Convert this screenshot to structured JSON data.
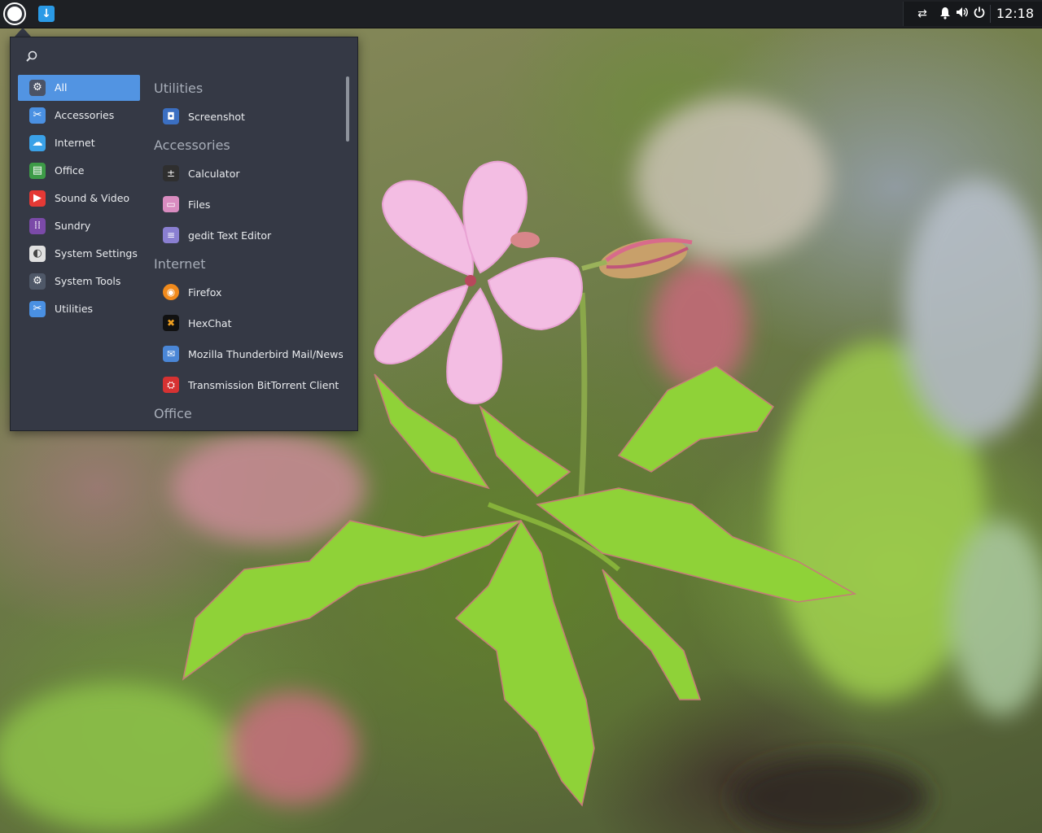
{
  "panel": {
    "menu_button_icon": "menu-circle-icon",
    "update_icon": "download-update-icon",
    "tray_icons": [
      "network-transfer-icon",
      "notification-bell-icon",
      "volume-icon",
      "power-icon"
    ],
    "clock": "12:18"
  },
  "menu": {
    "search_icon": "search-icon",
    "search_placeholder": "",
    "categories": [
      {
        "label": "All",
        "icon": "gear-icon",
        "color": "#4b5366",
        "active": true
      },
      {
        "label": "Accessories",
        "icon": "scissors-icon",
        "color": "#4a90e2"
      },
      {
        "label": "Internet",
        "icon": "cloud-icon",
        "color": "#3aa1e8"
      },
      {
        "label": "Office",
        "icon": "document-icon",
        "color": "#3d9b47"
      },
      {
        "label": "Sound & Video",
        "icon": "play-icon",
        "color": "#e53935"
      },
      {
        "label": "Sundry",
        "icon": "grid-icon",
        "color": "#7b4aa8"
      },
      {
        "label": "System Settings",
        "icon": "toggle-icon",
        "color": "#e0e0e0"
      },
      {
        "label": "System Tools",
        "icon": "gear-icon",
        "color": "#4f5868"
      },
      {
        "label": "Utilities",
        "icon": "scissors-icon",
        "color": "#4a90e2"
      }
    ],
    "sections": [
      {
        "title": "Utilities",
        "apps": [
          {
            "label": "Screenshot",
            "icon": "camera-icon",
            "color": "#3b6fc2"
          }
        ]
      },
      {
        "title": "Accessories",
        "apps": [
          {
            "label": "Calculator",
            "icon": "calculator-icon",
            "color": "#2f2f2f"
          },
          {
            "label": "Files",
            "icon": "folder-icon",
            "color": "#d98cc0"
          },
          {
            "label": "gedit Text Editor",
            "icon": "text-editor-icon",
            "color": "#8a7fd1"
          }
        ]
      },
      {
        "title": "Internet",
        "apps": [
          {
            "label": "Firefox",
            "icon": "firefox-icon",
            "color": "#f08a1c"
          },
          {
            "label": "HexChat",
            "icon": "hexchat-icon",
            "color": "#111111"
          },
          {
            "label": "Mozilla Thunderbird Mail/News",
            "icon": "mail-icon",
            "color": "#4a86d6"
          },
          {
            "label": "Transmission BitTorrent Client",
            "icon": "transmission-icon",
            "color": "#d63232"
          }
        ]
      },
      {
        "title": "Office",
        "apps": []
      }
    ]
  }
}
